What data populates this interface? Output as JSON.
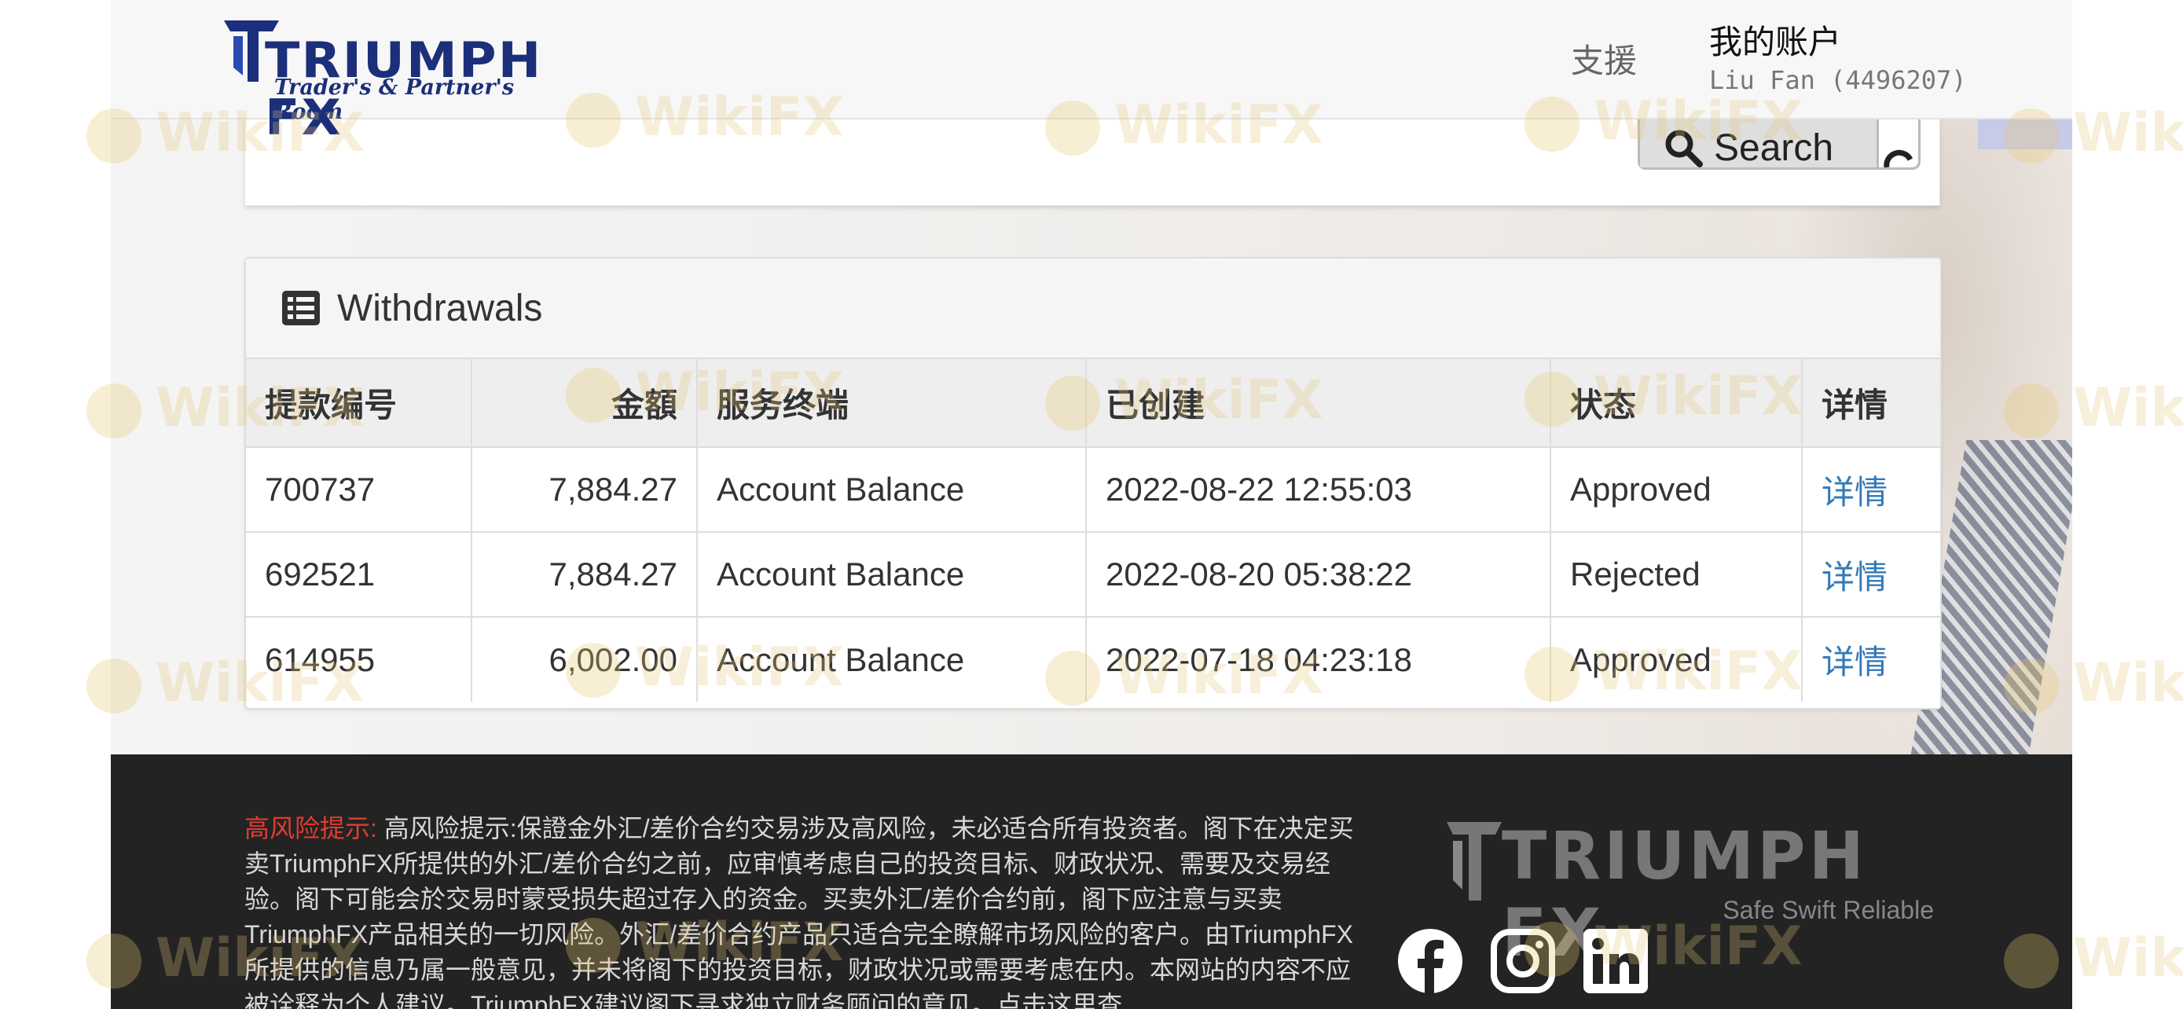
{
  "header": {
    "logo_text": "TRIUMPH FX",
    "logo_subtitle": "Trader's & Partner's Room",
    "support_label": "支援",
    "account_title": "我的账户",
    "account_user": "Liu Fan (4496207)"
  },
  "search": {
    "button_label": "Search",
    "button_icon": "search-icon",
    "reset_icon": "reset-icon"
  },
  "withdrawals": {
    "title": "Withdrawals",
    "icon": "list-icon",
    "columns": [
      "提款编号",
      "金額",
      "服务终端",
      "已创建",
      "状态",
      "详情"
    ],
    "rows": [
      {
        "id": "700737",
        "amount": "7,884.27",
        "terminal": "Account Balance",
        "created": "2022-08-22 12:55:03",
        "status": "Approved",
        "detail": "详情"
      },
      {
        "id": "692521",
        "amount": "7,884.27",
        "terminal": "Account Balance",
        "created": "2022-08-20 05:38:22",
        "status": "Rejected",
        "detail": "详情"
      },
      {
        "id": "614955",
        "amount": "6,002.00",
        "terminal": "Account Balance",
        "created": "2022-07-18 04:23:18",
        "status": "Approved",
        "detail": "详情"
      }
    ]
  },
  "footer": {
    "risk_label": "高风险提示:",
    "risk_text": " 高风险提示:保證金外汇/差价合约交易涉及高风险，未必适合所有投资者。阁下在决定买卖TriumphFX所提供的外汇/差价合约之前，应审慎考虑自己的投资目标、财政状况、需要及交易经验。阁下可能会於交易时蒙受损失超过存入的资金。买卖外汇/差价合约前，阁下应注意与买卖TriumphFX产品相关的一切风险。外汇/差价合约产品只适合完全瞭解市场风险的客户。由TriumphFX所提供的信息乃属一般意见，并未将阁下的投资目标，财政状况或需要考虑在内。本网站的内容不应被诠释为个人建议。TriumphFX建议阁下寻求独立财务顾问的意见。点击这里查",
    "logo_text": "TRIUMPH FX",
    "tagline": "Safe Swift Reliable",
    "social": [
      "facebook-icon",
      "instagram-icon",
      "linkedin-icon"
    ]
  },
  "watermark": "WikiFX",
  "colors": {
    "brand": "#1b2f7a",
    "link": "#337ab7",
    "risk_red": "#e03c31",
    "footer_bg": "#232323"
  }
}
